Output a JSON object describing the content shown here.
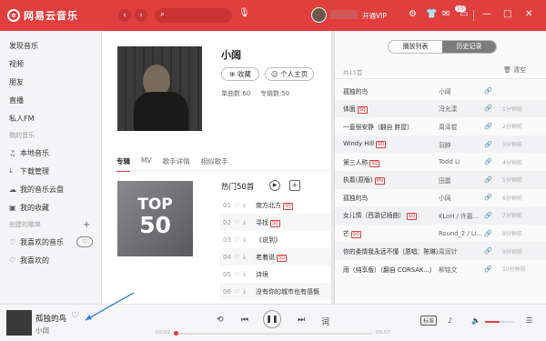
{
  "app": {
    "name": "网易云音乐",
    "logo_glyph": "e",
    "accent": "#e13e3e"
  },
  "header": {
    "back_icon": "chevron-left-icon",
    "forward_icon": "chevron-right-icon",
    "search_placeholder": "",
    "vip_label": "开通VIP",
    "msg_badge": "15"
  },
  "sidebar": {
    "top_items": [
      "发现音乐",
      "视频",
      "朋友",
      "直播",
      "私人FM"
    ],
    "my_music_label": "我的音乐",
    "my_music_items": [
      {
        "icon": "music-note-icon",
        "label": "本地音乐"
      },
      {
        "icon": "download-icon",
        "label": "下载管理"
      },
      {
        "icon": "cloud-icon",
        "label": "我的音乐云盘"
      },
      {
        "icon": "collection-icon",
        "label": "我的收藏"
      }
    ],
    "created_label": "创建的歌单",
    "created_add": "+",
    "created_items": [
      {
        "icon": "heart-icon",
        "label": "我喜欢的音乐"
      },
      {
        "icon": "heart-icon",
        "label": "我喜欢的"
      }
    ]
  },
  "artist": {
    "name": "小阔",
    "collect_label": "收藏",
    "homepage_label": "个人主页",
    "song_count": "单曲数:60",
    "album_count": "专辑数:50",
    "tabs": [
      "专辑",
      "MV",
      "歌手详情",
      "相似歌手"
    ],
    "cover_title_a": "TOP",
    "cover_title_b": "50",
    "hot_title": "热门50首",
    "hot_songs": [
      {
        "num": "01",
        "title": "南方北方",
        "sq": "SQ"
      },
      {
        "num": "02",
        "title": "寻找",
        "sq": "SQ"
      },
      {
        "num": "03",
        "title": "《说到》",
        "sq": ""
      },
      {
        "num": "04",
        "title": "老着说",
        "sq": "SQ"
      },
      {
        "num": "05",
        "title": "诗境",
        "sq": ""
      },
      {
        "num": "06",
        "title": "没有你的城市也有感慨",
        "sq": ""
      }
    ]
  },
  "history": {
    "tab_playlist": "播放列表",
    "tab_history": "历史记录",
    "count": "共11首",
    "clear_label": "清空",
    "rows": [
      {
        "title": "孤独的鸟",
        "tag": "",
        "artist": "小阔",
        "when": ""
      },
      {
        "title": "体面",
        "tag": "SQ",
        "artist": "冯允漾",
        "when": "1分钟前"
      },
      {
        "title": "一直很安静（翻自 胖屋）",
        "tag": "",
        "artist": "周泽锟",
        "when": "2分钟前"
      },
      {
        "title": "Windy Hill",
        "tag": "SQ",
        "artist": "羽肿",
        "when": "3分钟前"
      },
      {
        "title": "第三人称",
        "tag": "SQ",
        "artist": "Todd Li",
        "when": "4分钟前"
      },
      {
        "title": "执着(原版)",
        "tag": "MV",
        "artist": "田震",
        "when": "5分钟前"
      },
      {
        "title": "孤独的鸟",
        "tag": "",
        "artist": "小阔",
        "when": "6分钟前"
      },
      {
        "title": "女儿情（西游记插曲）",
        "tag": "SQ",
        "artist": "KLoH / 许嘉...",
        "when": "7分钟前"
      },
      {
        "title": "芒",
        "tag": "SQ",
        "artist": "Round_2 / Li...",
        "when": "8分钟前"
      },
      {
        "title": "你的柔情我永远不懂（原唱：陈琳）",
        "tag": "",
        "artist": "周润针",
        "when": "9分钟前"
      },
      {
        "title": "雨（纯享版）（翻自 CORSAK...）",
        "tag": "",
        "artist": "柳铭文",
        "when": "10分钟前"
      }
    ]
  },
  "player": {
    "title": "孤独的鸟",
    "artist": "小阔",
    "time_current": "00:02",
    "time_total": "05:07",
    "progress": 0.01,
    "lyric_label": "词",
    "quality_label": "标准",
    "volume": 0.5
  }
}
